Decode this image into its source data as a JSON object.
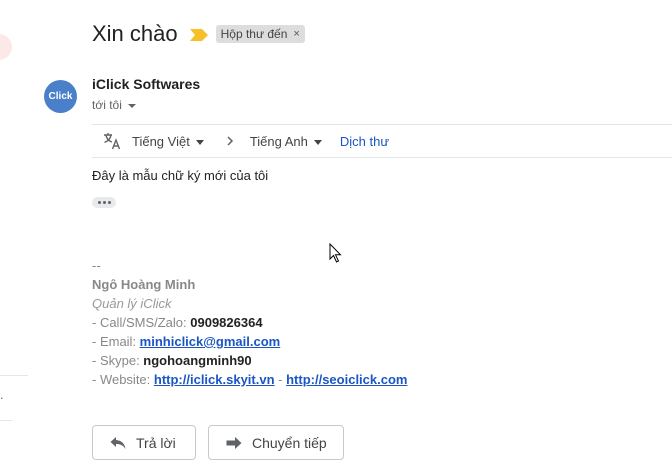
{
  "email": {
    "subject": "Xin chào",
    "label": "Hộp thư đến",
    "label_close": "×",
    "avatar_text": "Click",
    "sender": "iClick Softwares",
    "recipient": "tới tôi"
  },
  "translate": {
    "source_lang": "Tiếng Việt",
    "target_lang": "Tiếng Anh",
    "translate_link": "Dịch thư"
  },
  "body": {
    "line": "Đây là mẫu chữ ký mới của tôi"
  },
  "signature": {
    "separator": "--",
    "name": "Ngô Hoàng Minh",
    "role": "Quản lý iClick",
    "phone_label": "- Call/SMS/Zalo: ",
    "phone": "0909826364",
    "email_label": "- Email: ",
    "email": "minhiclick@gmail.com",
    "skype_label": "- Skype: ",
    "skype": "ngohoangminh90",
    "website_label": "- Website: ",
    "website1": "http://iclick.skyit.vn",
    "website_sep": " - ",
    "website2": "http://seoiclick.com"
  },
  "actions": {
    "reply": "Trả lời",
    "forward": "Chuyển tiếp"
  },
  "sidebar": {
    "mark": "."
  },
  "colors": {
    "important": "#f6c026",
    "avatar": "#4a7fc9",
    "link": "#1a56c4"
  },
  "icons": {
    "important": "important-marker-icon",
    "translate": "translate-icon",
    "chevron": "chevron-right-icon",
    "reply": "reply-arrow-icon",
    "forward": "forward-arrow-icon",
    "cursor": "mouse-pointer-icon"
  }
}
